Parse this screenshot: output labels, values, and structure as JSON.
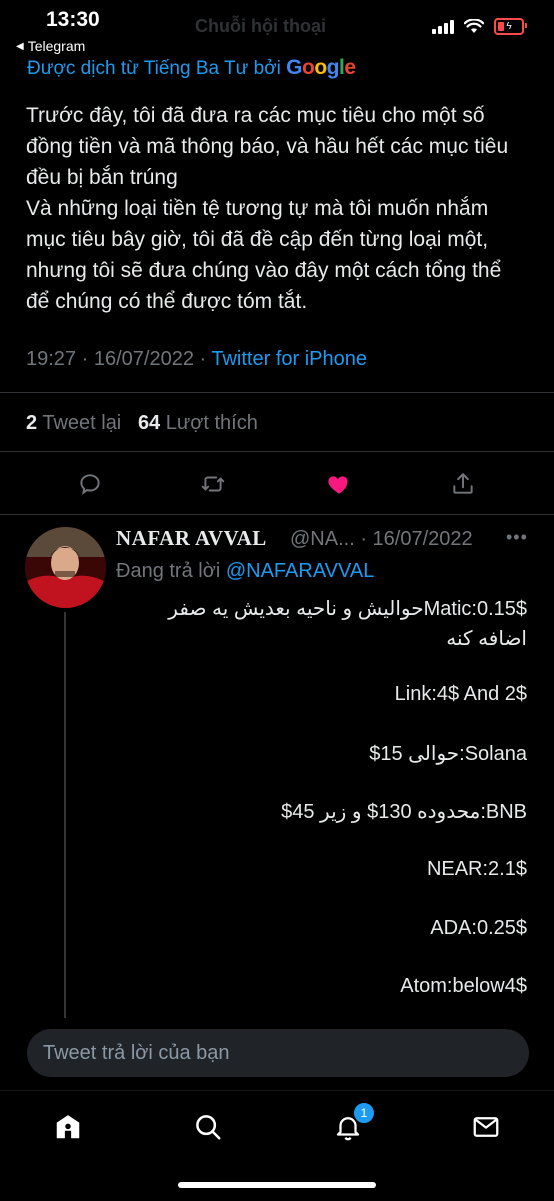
{
  "status": {
    "time": "13:30",
    "back_app": "Telegram",
    "header_title": "Chuỗi hội thoại"
  },
  "tweet": {
    "translated_label": "Được dịch từ Tiếng Ba Tư bởi",
    "translated_brand": "Google",
    "text": "Trước đây, tôi đã đưa ra các mục tiêu cho một số đồng tiền và mã thông báo, và hầu hết các mục tiêu đều bị bắn trúng\nVà những loại tiền tệ tương tự mà tôi muốn nhắm mục tiêu bây giờ, tôi đã đề cập đến từng loại một, nhưng tôi sẽ đưa chúng vào đây một cách tổng thể để chúng có thể được tóm tắt.",
    "time": "19:27",
    "date": "16/07/2022",
    "source": "Twitter for iPhone",
    "retweets_count": "2",
    "retweets_label": "Tweet lại",
    "likes_count": "64",
    "likes_label": "Lượt thích",
    "liked_color": "#f91880"
  },
  "reply": {
    "name": "NAFAR AVVAL",
    "handle": "@NA...",
    "date": "· 16/07/2022",
    "more": "•••",
    "replying_label": "Đang trả lời",
    "replying_handle": "@NAFARAVVAL",
    "lines": [
      "Matic:0.15$حوالیش و ناحیه بعدیش یه صفر",
      "اضافه کنه",
      "Link:4$ And 2$",
      "Solana:حوالی 15$",
      "BNB:محدوده 130$ و زیر 45$",
      "NEAR:2.1$",
      "ADA:0.25$",
      "Atom:below4$"
    ]
  },
  "composer": {
    "placeholder": "Tweet trả lời của bạn"
  },
  "nav": {
    "notifications_badge": "1"
  },
  "colors": {
    "accent": "#1d9bf0",
    "like": "#f91880",
    "muted": "#71767b"
  }
}
